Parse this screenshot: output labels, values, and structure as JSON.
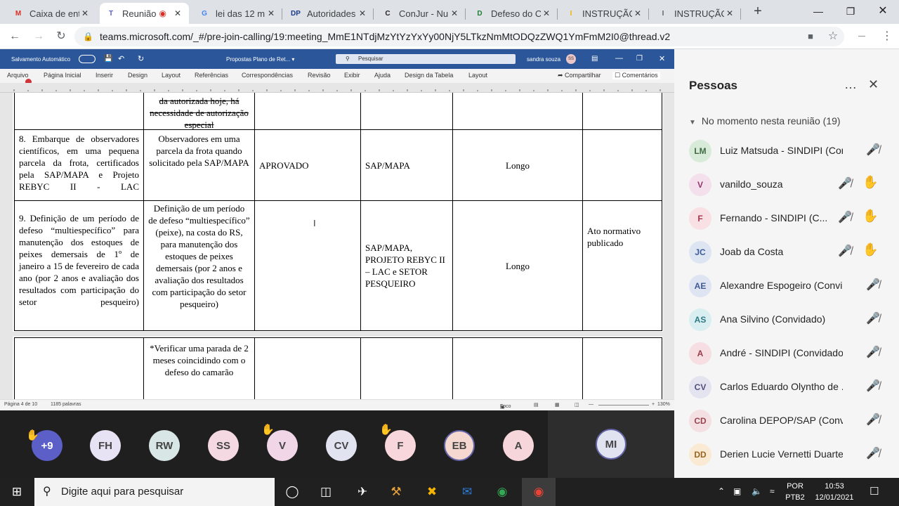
{
  "tabs": [
    {
      "title": "Caixa de ent",
      "fav": "M",
      "color": "#d93025"
    },
    {
      "title": "Reunião",
      "fav": "T",
      "color": "#5b5fc7"
    },
    {
      "title": "lei das 12 m",
      "fav": "G",
      "color": "#4285f4"
    },
    {
      "title": "Autoridades",
      "fav": "DP",
      "color": "#1a3c8b"
    },
    {
      "title": "ConJur - Nu",
      "fav": "C",
      "color": "#222"
    },
    {
      "title": "Defeso do C",
      "fav": "D",
      "color": "#1e7e34"
    },
    {
      "title": "INSTRUÇÃO",
      "fav": "I",
      "color": "#f4b400"
    },
    {
      "title": "INSTRUÇÃO",
      "fav": "I",
      "color": "#5f6368"
    }
  ],
  "browser": {
    "url": "teams.microsoft.com/_#/pre-join-calling/19:meeting_MmE1NTdjMzYtYzYxYy00NjY5LTkzNmMtODQzZWQ1YmFmM2I0@thread.v2"
  },
  "word": {
    "autosave": "Salvamento Automático",
    "doc_title": "Propostas Plano de Ret... ▾",
    "search": "Pesquisar",
    "user": "sandra souza",
    "user_initials": "SS",
    "menu": [
      "Arquivo",
      "Página Inicial",
      "Inserir",
      "Design",
      "Layout",
      "Referências",
      "Correspondências",
      "Revisão",
      "Exibir",
      "Ajuda",
      "Design da Tabela",
      "Layout"
    ],
    "share": "Compartilhar",
    "comments": "Comentários",
    "status_page": "Página 4 de 10",
    "status_words": "1185 palavras",
    "focus": "Foco",
    "zoom": "130%"
  },
  "table": {
    "r0": {
      "c1": "da autorizada hoje, há necessidade de autorização especial"
    },
    "r1": {
      "c0": "8. Embarque de observadores científicos, em uma pequena parcela da frota, certificados pela SAP/MAPA e Projeto REBYC II - LAC",
      "c1": "Observadores em uma parcela da frota quando solicitado pela SAP/MAPA",
      "c2": "APROVADO",
      "c3": "SAP/MAPA",
      "c4": "Longo",
      "c5": ""
    },
    "r2": {
      "c0": "9. Definição de um período de defeso “multiespecífico” para manutenção dos estoques de peixes demersais de 1º de janeiro a 15 de fevereiro de cada ano (por 2 anos e avaliação dos resultados com participação do setor pesqueiro)",
      "c1": "Definição de um período de defeso “multiespecífico” (peixe), na costa do RS, para manutenção dos estoques de peixes demersais (por 2 anos e avaliação dos resultados com participação do setor pesqueiro)",
      "c2": "",
      "c3": "SAP/MAPA, PROJETO REBYC II – LAC e SETOR PESQUEIRO",
      "c4": "Longo",
      "c5": "Ato normativo publicado"
    },
    "r3": {
      "c1": "*Verificar uma parada de 2 meses coincidindo com o defeso do camarão"
    }
  },
  "video": {
    "overflow": "+9",
    "avatars": [
      {
        "i": "FH",
        "bg": "#e8e3f4",
        "hand": false
      },
      {
        "i": "RW",
        "bg": "#d8e7e5",
        "hand": false
      },
      {
        "i": "SS",
        "bg": "#f4d9e2",
        "hand": false
      },
      {
        "i": "V",
        "bg": "#f1d6e8",
        "hand": true
      },
      {
        "i": "CV",
        "bg": "#e1e3f1",
        "hand": false
      },
      {
        "i": "F",
        "bg": "#f7d6dc",
        "hand": true
      },
      {
        "i": "EB",
        "bg": "#f5d8d0",
        "hand": false
      },
      {
        "i": "A",
        "bg": "#f6d6da",
        "hand": false
      }
    ],
    "self": "MI"
  },
  "people": {
    "title": "Pessoas",
    "section": "No momento nesta reunião  (19)",
    "list": [
      {
        "i": "LM",
        "name": "Luiz Matsuda - SINDIPI (Con...",
        "bg": "#d8ebd9",
        "fg": "#3f6b42",
        "hand": false
      },
      {
        "i": "V",
        "name": "vanildo_souza",
        "bg": "#f4e0ec",
        "fg": "#8e3a6e",
        "hand": true
      },
      {
        "i": "F",
        "name": "Fernando - SINDIPI (C...",
        "bg": "#f9e0e4",
        "fg": "#a4374b",
        "hand": true
      },
      {
        "i": "JC",
        "name": "Joab da Costa",
        "bg": "#dde5f3",
        "fg": "#3b5b9a",
        "hand": true
      },
      {
        "i": "AE",
        "name": "Alexandre Espogeiro (Convi...",
        "bg": "#dfe4f3",
        "fg": "#405a96",
        "hand": false
      },
      {
        "i": "AS",
        "name": "Ana Silvino (Convidado)",
        "bg": "#d8eef0",
        "fg": "#2f7a84",
        "hand": false
      },
      {
        "i": "A",
        "name": "André - SINDIPI (Convidado)",
        "bg": "#f6dee2",
        "fg": "#9a3b4b",
        "hand": false
      },
      {
        "i": "CV",
        "name": "Carlos Eduardo Olyntho de ...",
        "bg": "#e4e4f0",
        "fg": "#50507e",
        "hand": false
      },
      {
        "i": "CD",
        "name": "Carolina DEPOP/SAP (Convi...",
        "bg": "#f4dfe2",
        "fg": "#98434f",
        "hand": false
      },
      {
        "i": "DD",
        "name": "Derien Lucie Vernetti Duarte",
        "bg": "#fbead3",
        "fg": "#9a6420",
        "hand": false
      }
    ]
  },
  "taskbar": {
    "search": "Digite aqui para pesquisar",
    "lang1": "POR",
    "lang2": "PTB2",
    "time": "10:53",
    "date": "12/01/2021"
  }
}
